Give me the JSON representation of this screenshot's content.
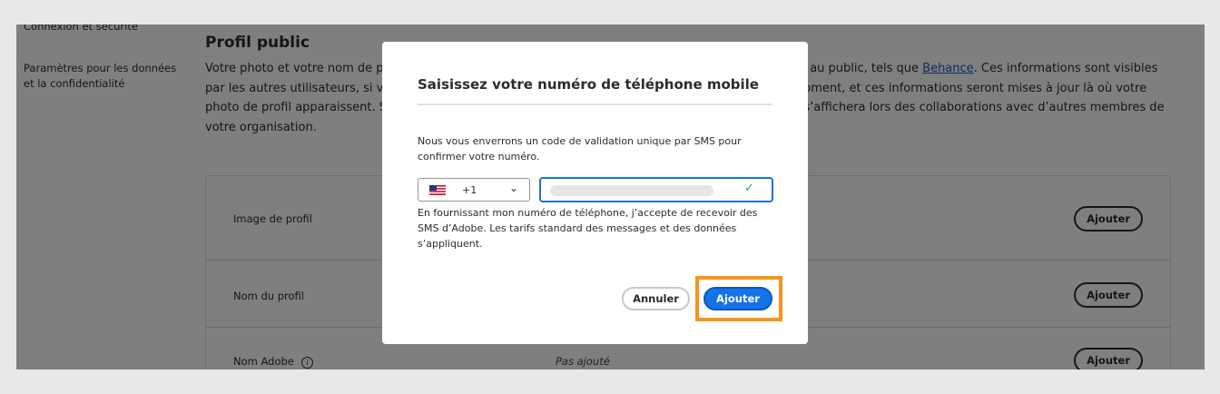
{
  "sidebar": {
    "items": [
      {
        "label": "Connexion et sécurité"
      },
      {
        "label": "Paramètres pour les données et la confidentialité"
      }
    ]
  },
  "profile": {
    "title": "Profil public",
    "paragraph_before_link": "Votre photo et votre nom de profil s’affichent sur les produits et services Adobe et à des sites ouverts au public, tels que ",
    "link": "Behance",
    "paragraph_after_link": ". Ces informations sont visibles par les autres utilisateurs, si vous le souhaitez. Vous pouvez mettre à jour votre profil public à tout moment, et ces informations seront mises à jour là où votre photo de profil apparaissent. Si vous appartenez à l’organisation d’une entreprise, votre profil public s’affichera lors des collaborations avec d’autres membres de votre organisation.",
    "rows": [
      {
        "label": "Image de profil",
        "value": "",
        "action": "Ajouter"
      },
      {
        "label": "Nom du profil",
        "value": "",
        "action": "Ajouter"
      },
      {
        "label": "Nom Adobe",
        "value": "Pas ajouté",
        "action": "Ajouter"
      }
    ]
  },
  "modal": {
    "title": "Saisissez votre numéro de téléphone mobile",
    "description": "Nous vous enverrons un code de validation unique par SMS pour confirmer votre numéro.",
    "country_code": "+1",
    "country_flag": "us-flag-icon",
    "phone_placeholder": "",
    "consent": "En fournissant mon numéro de téléphone, j’accepte de recevoir des SMS d’Adobe. Les tarifs standard des messages et des données s’appliquent.",
    "cancel_label": "Annuler",
    "add_label": "Ajouter"
  },
  "colors": {
    "accent": "#1473e6",
    "highlight": "#f7941d",
    "valid": "#2d9d78"
  }
}
